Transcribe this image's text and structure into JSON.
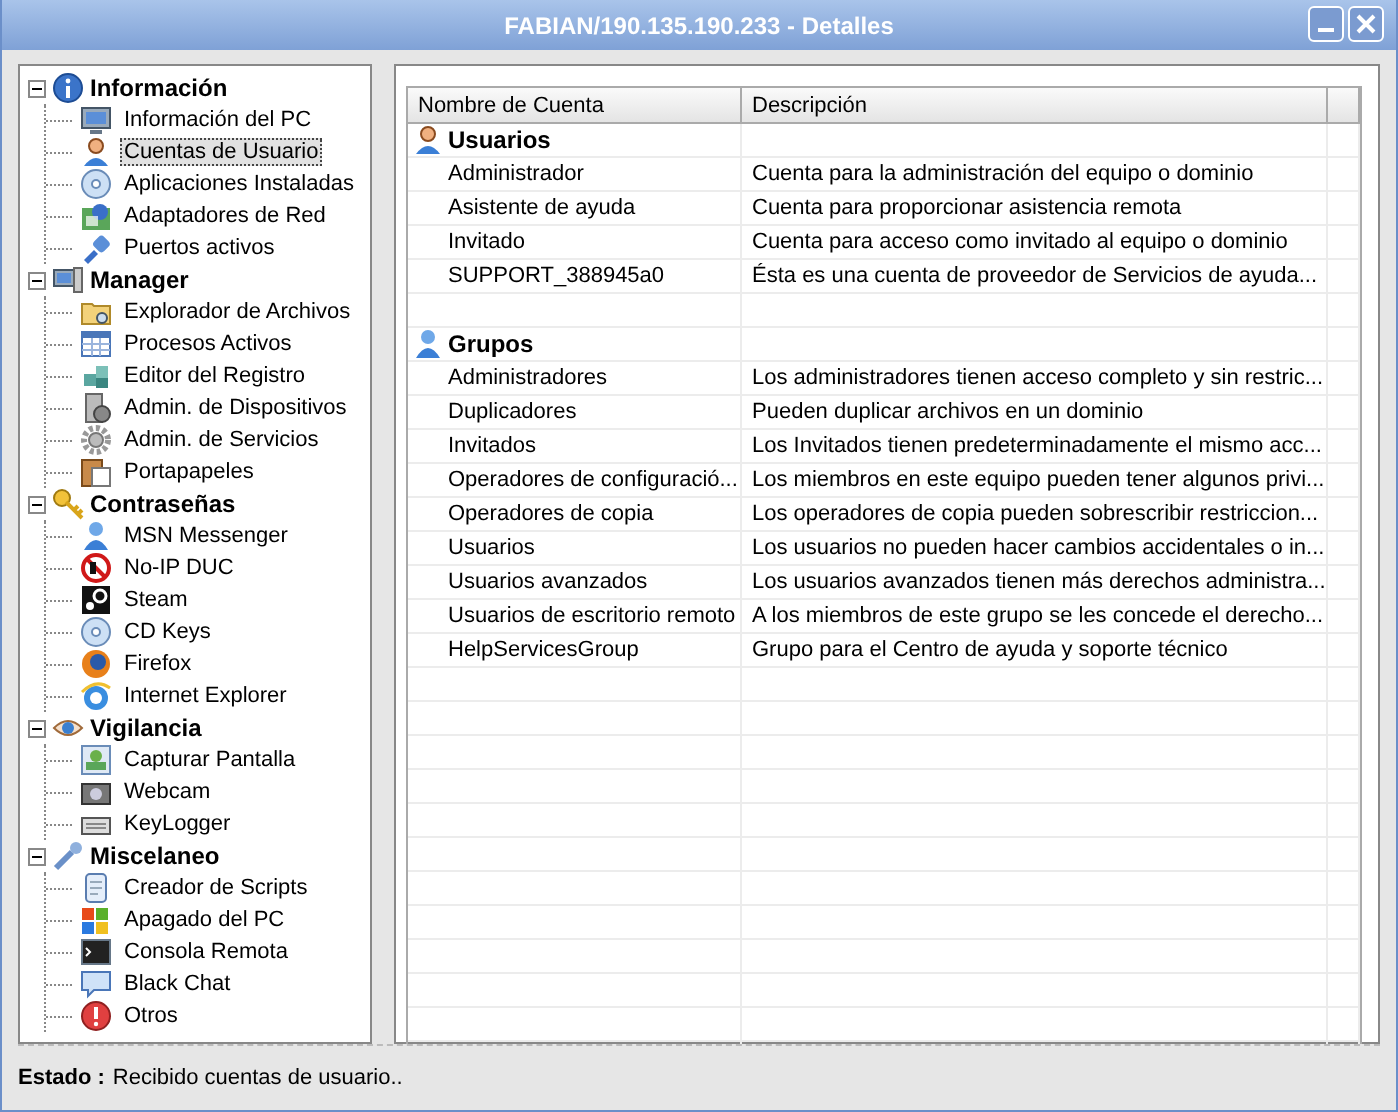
{
  "window": {
    "title": "FABIAN/190.135.190.233 - Detalles"
  },
  "tree": [
    {
      "label": "Información",
      "expanded": true,
      "children": [
        {
          "label": "Información del PC",
          "selected": false
        },
        {
          "label": "Cuentas de Usuario",
          "selected": true
        },
        {
          "label": "Aplicaciones Instaladas",
          "selected": false
        },
        {
          "label": "Adaptadores de Red",
          "selected": false
        },
        {
          "label": "Puertos activos",
          "selected": false
        }
      ]
    },
    {
      "label": "Manager",
      "expanded": true,
      "children": [
        {
          "label": "Explorador de Archivos",
          "selected": false
        },
        {
          "label": "Procesos Activos",
          "selected": false
        },
        {
          "label": "Editor del Registro",
          "selected": false
        },
        {
          "label": "Admin. de Dispositivos",
          "selected": false
        },
        {
          "label": "Admin. de Servicios",
          "selected": false
        },
        {
          "label": "Portapapeles",
          "selected": false
        }
      ]
    },
    {
      "label": "Contraseñas",
      "expanded": true,
      "children": [
        {
          "label": "MSN Messenger",
          "selected": false
        },
        {
          "label": "No-IP DUC",
          "selected": false
        },
        {
          "label": "Steam",
          "selected": false
        },
        {
          "label": "CD Keys",
          "selected": false
        },
        {
          "label": "Firefox",
          "selected": false
        },
        {
          "label": "Internet Explorer",
          "selected": false
        }
      ]
    },
    {
      "label": "Vigilancia",
      "expanded": true,
      "children": [
        {
          "label": "Capturar Pantalla",
          "selected": false
        },
        {
          "label": "Webcam",
          "selected": false
        },
        {
          "label": "KeyLogger",
          "selected": false
        }
      ]
    },
    {
      "label": "Miscelaneo",
      "expanded": true,
      "children": [
        {
          "label": "Creador de Scripts",
          "selected": false
        },
        {
          "label": "Apagado del PC",
          "selected": false
        },
        {
          "label": "Consola Remota",
          "selected": false
        },
        {
          "label": "Black Chat",
          "selected": false
        },
        {
          "label": "Otros",
          "selected": false
        }
      ]
    }
  ],
  "table": {
    "columns": [
      "Nombre de Cuenta",
      "Descripción"
    ],
    "sections": [
      {
        "label": "Usuarios",
        "rows": [
          [
            "Administrador",
            "Cuenta para la administración del equipo o dominio"
          ],
          [
            "Asistente de ayuda",
            "Cuenta para proporcionar asistencia remota"
          ],
          [
            "Invitado",
            "Cuenta para acceso como invitado al equipo o dominio"
          ],
          [
            "SUPPORT_388945a0",
            "Ésta es una cuenta de proveedor de Servicios de ayuda..."
          ]
        ]
      },
      {
        "label": "Grupos",
        "rows": [
          [
            "Administradores",
            "Los administradores tienen acceso completo y sin restric..."
          ],
          [
            "Duplicadores",
            "Pueden duplicar archivos en un dominio"
          ],
          [
            "Invitados",
            "Los Invitados tienen predeterminadamente el mismo acc..."
          ],
          [
            "Operadores de configuració...",
            "Los miembros en este equipo pueden tener algunos privi..."
          ],
          [
            "Operadores de copia",
            "Los operadores de copia pueden sobrescribir restriccion..."
          ],
          [
            "Usuarios",
            "Los usuarios no pueden hacer cambios accidentales o in..."
          ],
          [
            "Usuarios avanzados",
            "Los usuarios avanzados tienen más derechos administra..."
          ],
          [
            "Usuarios de escritorio remoto",
            "A los miembros de este grupo se les concede el derecho..."
          ],
          [
            "HelpServicesGroup",
            "Grupo para el Centro de ayuda y soporte técnico"
          ]
        ]
      }
    ]
  },
  "status": {
    "label": "Estado :",
    "text": "Recibido cuentas de usuario.."
  }
}
